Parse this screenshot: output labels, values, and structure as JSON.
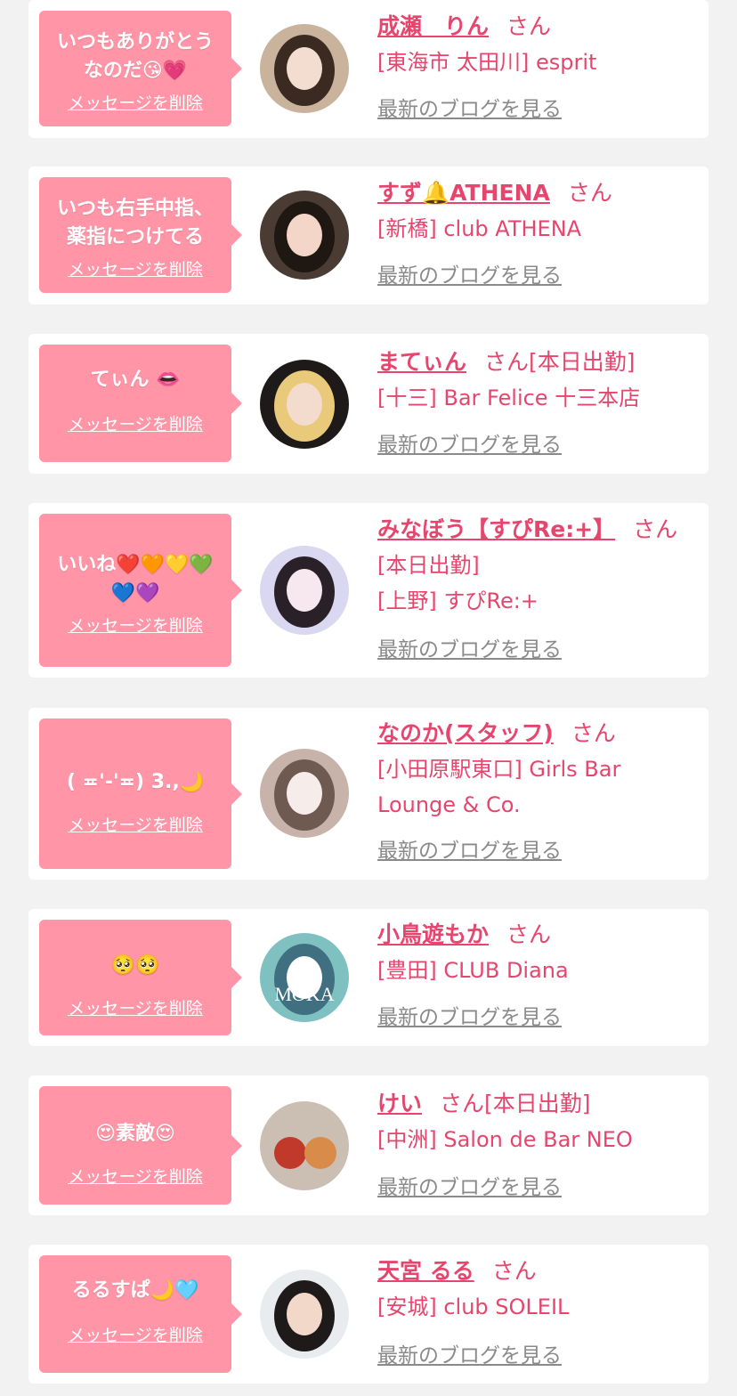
{
  "ui": {
    "delete_label": "メッセージを削除",
    "blog_label": "最新のブログを見る",
    "honorific": "さん"
  },
  "entries": [
    {
      "message_lines": [
        "いつもありがとう",
        "なのだ😘💗"
      ],
      "name": "成瀬　りん",
      "status": "",
      "lines": [
        "[東海市 太田川] esprit"
      ],
      "avatar_colors": [
        "#c9b39c",
        "#3a2a22",
        "#f3dcd0"
      ]
    },
    {
      "message_lines": [
        "いつも右手中指、",
        "薬指につけてる"
      ],
      "name": "すず🔔ATHENA",
      "status": "",
      "lines": [
        "[新橋] club ATHENA"
      ],
      "avatar_colors": [
        "#4a3b33",
        "#1f1712",
        "#f4d6c9"
      ]
    },
    {
      "message_lines": [
        "てぃん 👄"
      ],
      "name": "まてぃん",
      "status": "[本日出勤]",
      "lines": [
        "[十三] Bar Felice 十三本店"
      ],
      "avatar_colors": [
        "#1e1a1a",
        "#e9c97a",
        "#f3dccd"
      ]
    },
    {
      "message_lines": [
        "いいね❤️🧡💛💚",
        "💙💜"
      ],
      "name": "みなぼう【すぴRe:+】",
      "status": "",
      "lines": [
        "[本日出勤]",
        "[上野] すぴRe:+"
      ],
      "avatar_colors": [
        "#d9d8f0",
        "#2a2028",
        "#f7e7ee"
      ]
    },
    {
      "message_lines": [
        "( ≖'-'≖) 3.,🌙"
      ],
      "name": "なのか(スタッフ)",
      "status": "",
      "lines": [
        "[小田原駅東口] Girls Bar",
        "Lounge & Co."
      ],
      "avatar_colors": [
        "#c8b3aa",
        "#6f5a52",
        "#f6ecea"
      ]
    },
    {
      "message_lines": [
        "🥺🥺"
      ],
      "name": "小鳥遊もか",
      "status": "",
      "lines": [
        "[豊田] CLUB Diana"
      ],
      "avatar_colors": [
        "#7ec1c0",
        "#3f6f80",
        "#ffffff"
      ],
      "avatar_text": "MOKA"
    },
    {
      "message_lines": [
        "😍素敵😍"
      ],
      "name": "けい",
      "status": "[本日出勤]",
      "lines": [
        "[中洲] Salon de Bar NEO"
      ],
      "avatar_colors": [
        "#cbbfb4",
        "#c0392b",
        "#d98b4a"
      ]
    },
    {
      "message_lines": [
        "るるすぱ🌙🩵"
      ],
      "name": "天宮 るる",
      "status": "",
      "lines": [
        "[安城] club SOLEIL"
      ],
      "avatar_colors": [
        "#e9ecef",
        "#1f1a1a",
        "#f2d8c9"
      ]
    }
  ]
}
